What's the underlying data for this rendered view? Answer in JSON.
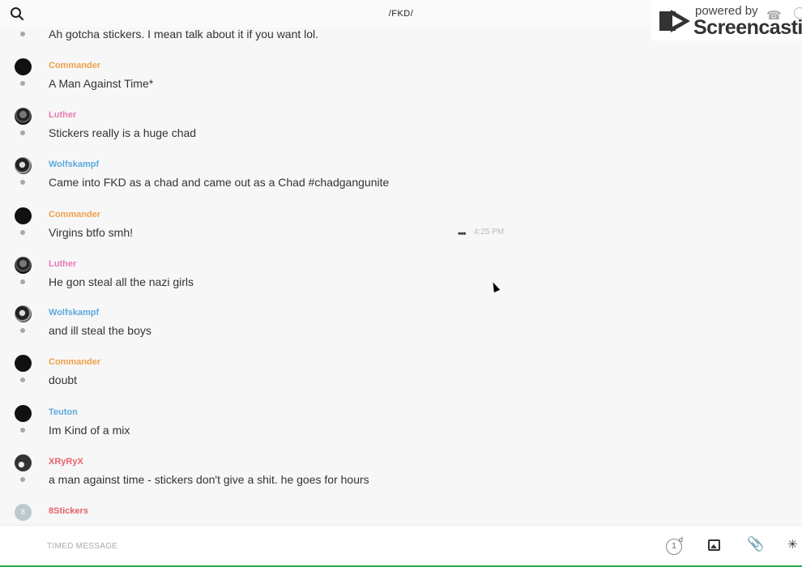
{
  "header": {
    "title": "/FKD/",
    "search_icon": "search-icon"
  },
  "watermark": {
    "line1": "powered by",
    "line2": "Screencastify",
    "icons": [
      "phone-icon",
      "info-icon"
    ]
  },
  "messages": [
    {
      "author": "",
      "text": "Ah gotcha stickers. I mean talk about it if you want lol."
    },
    {
      "author": "Commander",
      "color": "#f0a04b",
      "text": "A Man Against Time*"
    },
    {
      "author": "Luther",
      "color": "#e979b3",
      "text": "Stickers really is a huge chad"
    },
    {
      "author": "Wolfskampf",
      "color": "#5aa9dd",
      "text": "Came into FKD as a chad and came out as a Chad #chadgangunite"
    },
    {
      "author": "Commander",
      "color": "#f0a04b",
      "text": "Virgins btfo smh!",
      "time": "4:25 PM",
      "more": "•••"
    },
    {
      "author": "Luther",
      "color": "#e979b3",
      "text": "He gon steal all the nazi girls"
    },
    {
      "author": "Wolfskampf",
      "color": "#5aa9dd",
      "text": "and ill steal the boys"
    },
    {
      "author": "Commander",
      "color": "#f0a04b",
      "text": "doubt"
    },
    {
      "author": "Teuton",
      "color": "#5aa9dd",
      "text": "Im Kind of a mix"
    },
    {
      "author": "XRyRyX",
      "color": "#e8626a",
      "text": "a man against time - stickers don't give a shit. he goes for hours"
    },
    {
      "author": "8Stickers",
      "color": "#e8626a",
      "text": "",
      "avatar_letter": "8"
    }
  ],
  "composer": {
    "placeholder": "TIMED MESSAGE",
    "timer_value": "1",
    "timer_unit": "d",
    "icons": [
      "image-icon",
      "paperclip-icon",
      "sparkle-icon"
    ]
  },
  "colors": {
    "accent_green": "#2aa84a"
  }
}
